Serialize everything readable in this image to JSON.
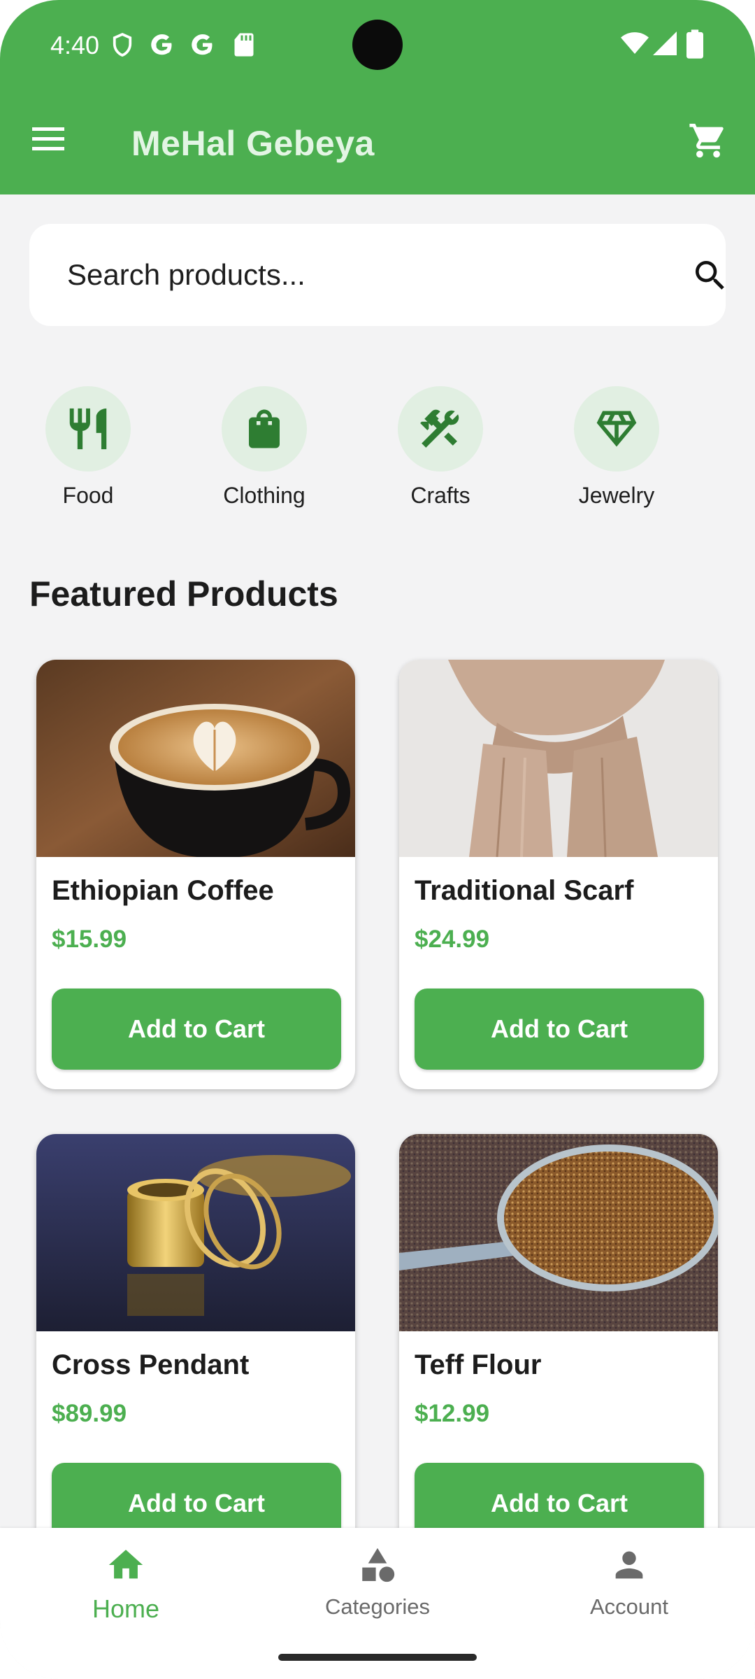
{
  "status_bar": {
    "time": "4:40"
  },
  "app_bar": {
    "title": "MeHal Gebeya",
    "menu_icon": "menu-icon",
    "cart_icon": "shopping-cart-icon"
  },
  "search": {
    "placeholder": "Search products...",
    "value": ""
  },
  "categories": [
    {
      "label": "Food",
      "icon": "restaurant-icon"
    },
    {
      "label": "Clothing",
      "icon": "shopping-bag-icon"
    },
    {
      "label": "Crafts",
      "icon": "hammer-wrench-icon"
    },
    {
      "label": "Jewelry",
      "icon": "diamond-icon"
    }
  ],
  "featured": {
    "title": "Featured Products",
    "products": [
      {
        "name": "Ethiopian Coffee",
        "price": "$15.99",
        "button": "Add to Cart"
      },
      {
        "name": "Traditional Scarf",
        "price": "$24.99",
        "button": "Add to Cart"
      },
      {
        "name": "Cross Pendant",
        "price": "$89.99",
        "button": "Add to Cart"
      },
      {
        "name": "Teff Flour",
        "price": "$12.99",
        "button": "Add to Cart"
      }
    ]
  },
  "bottom_nav": {
    "items": [
      {
        "label": "Home",
        "icon": "home-icon",
        "active": true
      },
      {
        "label": "Categories",
        "icon": "categories-icon",
        "active": false
      },
      {
        "label": "Account",
        "icon": "person-icon",
        "active": false
      }
    ]
  },
  "colors": {
    "primary": "#4caf50",
    "category_bg": "#e1efe2",
    "page_bg": "#f3f3f4"
  }
}
